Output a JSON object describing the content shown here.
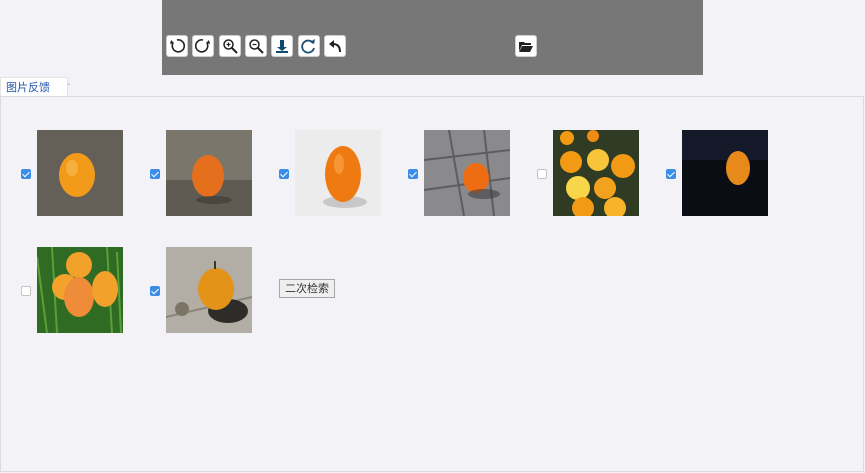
{
  "toolbar": {
    "buttons": [
      "rotate-left-icon",
      "rotate-right-icon",
      "zoom-in-icon",
      "zoom-out-icon",
      "download-icon",
      "redo-icon",
      "undo-icon"
    ],
    "folder_button": "folder-open-icon"
  },
  "tab": {
    "label": "图片反馈"
  },
  "results": [
    {
      "checked": true
    },
    {
      "checked": true
    },
    {
      "checked": true
    },
    {
      "checked": true
    },
    {
      "checked": false
    },
    {
      "checked": true
    },
    {
      "checked": false
    },
    {
      "checked": true
    }
  ],
  "actions": {
    "secondary_search_label": "二次检索"
  },
  "colors": {
    "checkbox_checked": "#3b8de8",
    "toolbar_bg": "#777777",
    "tab_text": "#2255aa"
  }
}
